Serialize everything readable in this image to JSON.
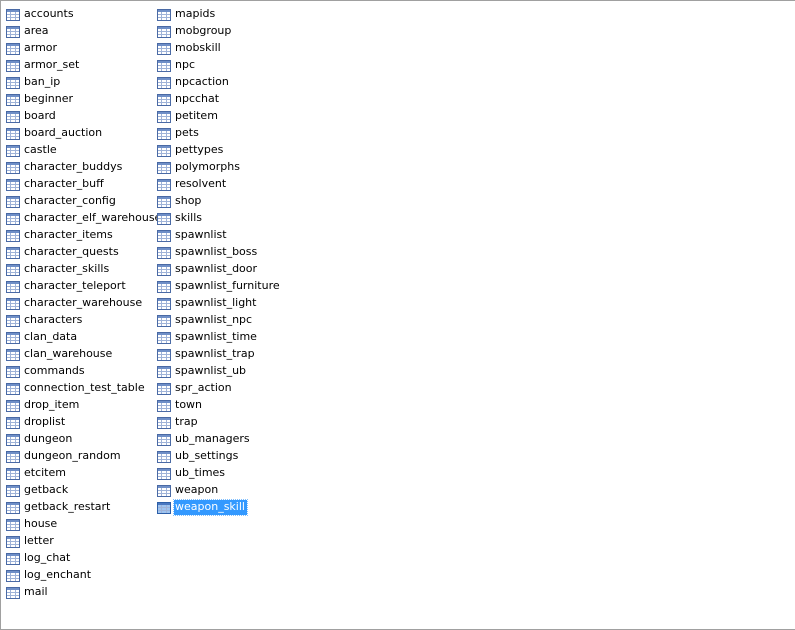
{
  "tables": {
    "column1": [
      "accounts",
      "area",
      "armor",
      "armor_set",
      "ban_ip",
      "beginner",
      "board",
      "board_auction",
      "castle",
      "character_buddys",
      "character_buff",
      "character_config",
      "character_elf_warehouse",
      "character_items",
      "character_quests",
      "character_skills",
      "character_teleport",
      "character_warehouse",
      "characters",
      "clan_data",
      "clan_warehouse",
      "commands",
      "connection_test_table",
      "drop_item",
      "droplist",
      "dungeon",
      "dungeon_random",
      "etcitem",
      "getback",
      "getback_restart",
      "house",
      "letter",
      "log_chat",
      "log_enchant",
      "mail"
    ],
    "column2": [
      "mapids",
      "mobgroup",
      "mobskill",
      "npc",
      "npcaction",
      "npcchat",
      "petitem",
      "pets",
      "pettypes",
      "polymorphs",
      "resolvent",
      "shop",
      "skills",
      "spawnlist",
      "spawnlist_boss",
      "spawnlist_door",
      "spawnlist_furniture",
      "spawnlist_light",
      "spawnlist_npc",
      "spawnlist_time",
      "spawnlist_trap",
      "spawnlist_ub",
      "spr_action",
      "town",
      "trap",
      "ub_managers",
      "ub_settings",
      "ub_times",
      "weapon",
      "weapon_skill"
    ],
    "selected": "weapon_skill"
  },
  "icon": "table-icon",
  "colors": {
    "selection": "#3399ff",
    "icon_header": "#6f8fc7",
    "icon_border": "#4a6aa5",
    "icon_cell": "#ffffff"
  }
}
